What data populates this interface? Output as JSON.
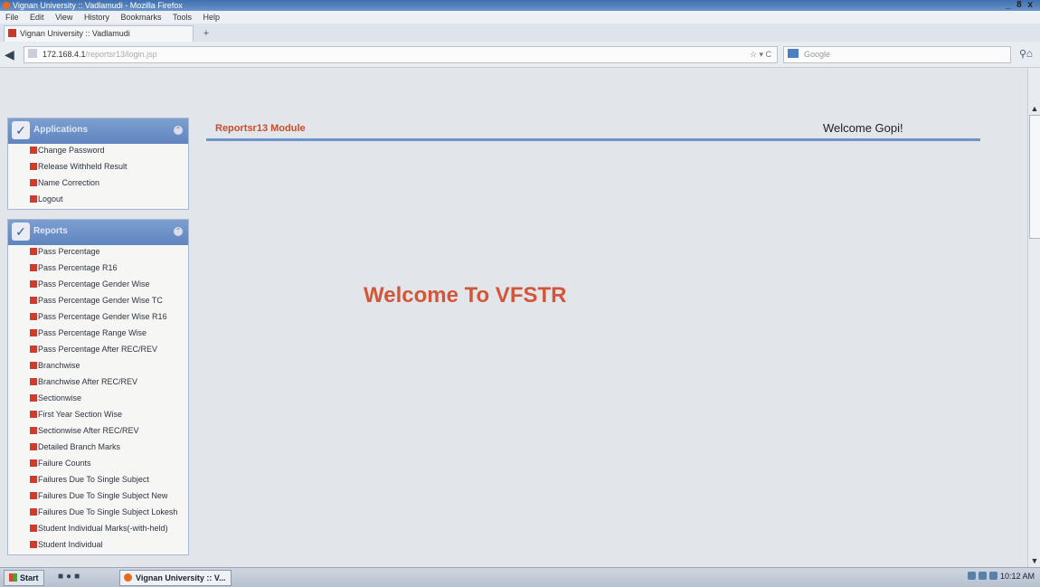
{
  "window": {
    "title": "Vignan University :: Vadlamudi - Mozilla Firefox",
    "controls": "_ 8 x"
  },
  "menu": [
    "File",
    "Edit",
    "View",
    "History",
    "Bookmarks",
    "Tools",
    "Help"
  ],
  "tab": {
    "label": "Vignan University :: Vadlamudi",
    "new_tab": "+"
  },
  "nav": {
    "url_host": "172.168.4.1",
    "url_path": "/reportsr13/login.jsp",
    "search_placeholder": "Google",
    "reload": "☆ ▾ C"
  },
  "sidebar": {
    "applications": {
      "title": "Applications",
      "items": [
        "Change Password",
        "Release Withheld Result",
        "Name Correction",
        "Logout"
      ]
    },
    "reports": {
      "title": "Reports",
      "items": [
        "Pass Percentage",
        "Pass Percentage R16",
        "Pass Percentage Gender Wise",
        "Pass Percentage Gender Wise TC",
        "Pass Percentage Gender Wise R16",
        "Pass Percentage Range Wise",
        "Pass Percentage After REC/REV",
        "Branchwise",
        "Branchwise After REC/REV",
        "Sectionwise",
        "First Year Section Wise",
        "Sectionwise After REC/REV",
        "Detailed Branch Marks",
        "Failure Counts",
        "Failures Due To Single Subject",
        "Failures Due To Single Subject New",
        "Failures Due To Single Subject Lokesh",
        "Student Individual Marks(-with-held)",
        "Student Individual"
      ]
    }
  },
  "content": {
    "module_title": "Reportsr13 Module",
    "welcome_user": "Welcome Gopi!",
    "main_message": "Welcome To VFSTR"
  },
  "taskbar": {
    "start": "Start",
    "task_label": "Vignan University :: V...",
    "clock": "10:12 AM"
  },
  "colors": {
    "accent_orange": "#d2563a",
    "panel_header_blue": "#6d8fc6",
    "divider_blue": "#6d93c9",
    "bullet_red": "#cd3d2d"
  }
}
